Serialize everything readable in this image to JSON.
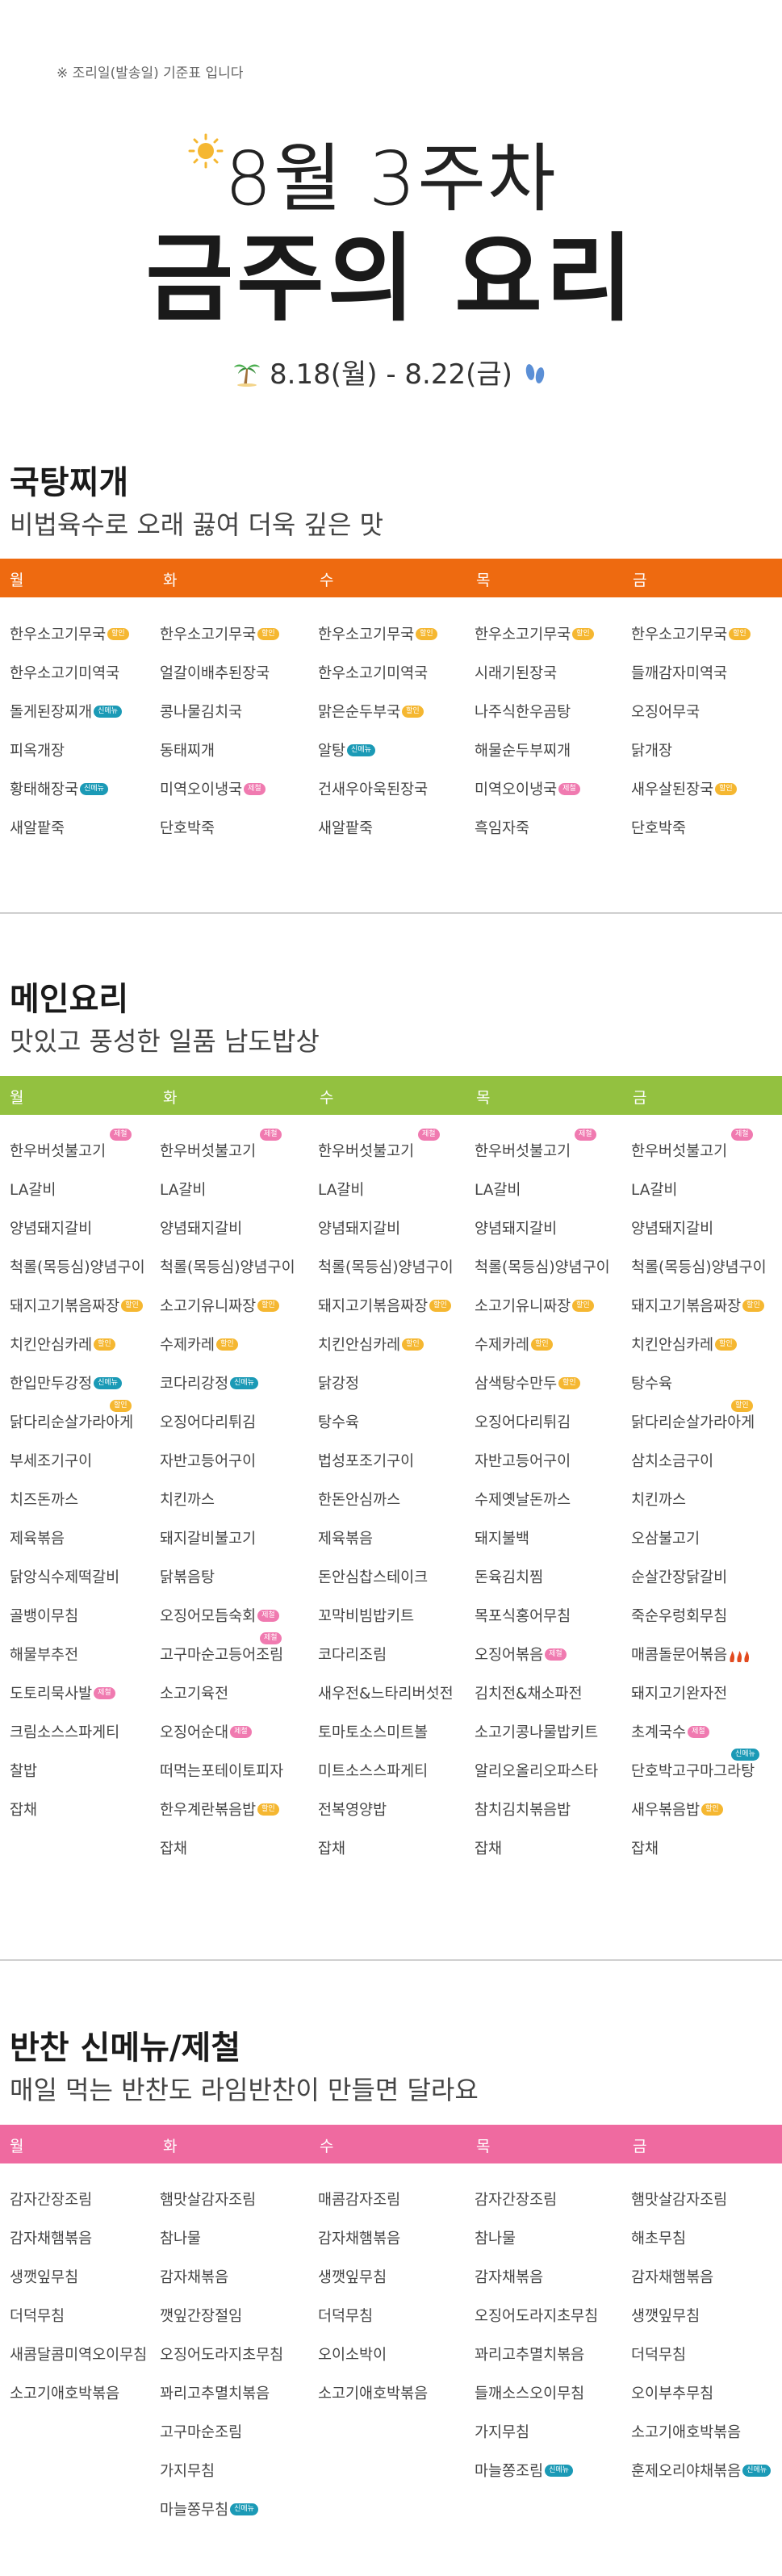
{
  "notice": "※ 조리일(발송일) 기준표 입니다",
  "hero": {
    "line1": "8월 3주차",
    "line2": "금주의 요리",
    "date_range": "8.18(월) - 8.22(금)"
  },
  "colors": {
    "orange": "#ee6a10",
    "green": "#93c140",
    "pink": "#ef6aa0",
    "badge_yellow": "#f5b731",
    "badge_pink": "#f07ab0",
    "badge_teal": "#1b9ab6"
  },
  "icons": [
    "sun-icon",
    "palm-icon",
    "feet-icon",
    "flame-icon"
  ],
  "days": [
    "월",
    "화",
    "수",
    "목",
    "금"
  ],
  "sections": [
    {
      "title": "국탕찌개",
      "subtitle": "비법육수로 오래 끓여 더욱 깊은 맛",
      "columns": [
        [
          {
            "name": "한우소고기무국",
            "badge": "할인",
            "badge_color": "yellow"
          },
          {
            "name": "한우소고기미역국"
          },
          {
            "name": "돌게된장찌개",
            "badge": "신메뉴",
            "badge_color": "teal"
          },
          {
            "name": "피옥개장"
          },
          {
            "name": "황태해장국",
            "badge": "신메뉴",
            "badge_color": "teal"
          },
          {
            "name": "새알팥죽"
          }
        ],
        [
          {
            "name": "한우소고기무국",
            "badge": "할인",
            "badge_color": "yellow"
          },
          {
            "name": "얼갈이배추된장국"
          },
          {
            "name": "콩나물김치국"
          },
          {
            "name": "동태찌개"
          },
          {
            "name": "미역오이냉국",
            "badge": "제철",
            "badge_color": "pink"
          },
          {
            "name": "단호박죽"
          }
        ],
        [
          {
            "name": "한우소고기무국",
            "badge": "할인",
            "badge_color": "yellow"
          },
          {
            "name": "한우소고기미역국"
          },
          {
            "name": "맑은순두부국",
            "badge": "할인",
            "badge_color": "yellow"
          },
          {
            "name": "알탕",
            "badge": "신메뉴",
            "badge_color": "teal"
          },
          {
            "name": "건새우아욱된장국"
          },
          {
            "name": "새알팥죽"
          }
        ],
        [
          {
            "name": "한우소고기무국",
            "badge": "할인",
            "badge_color": "yellow"
          },
          {
            "name": "시래기된장국"
          },
          {
            "name": "나주식한우곰탕"
          },
          {
            "name": "해물순두부찌개"
          },
          {
            "name": "미역오이냉국",
            "badge": "제철",
            "badge_color": "pink"
          },
          {
            "name": "흑임자죽"
          }
        ],
        [
          {
            "name": "한우소고기무국",
            "badge": "할인",
            "badge_color": "yellow"
          },
          {
            "name": "들깨감자미역국"
          },
          {
            "name": "오징어무국"
          },
          {
            "name": "닭개장"
          },
          {
            "name": "새우살된장국",
            "badge": "할인",
            "badge_color": "yellow"
          },
          {
            "name": "단호박죽"
          }
        ]
      ]
    },
    {
      "title": "메인요리",
      "subtitle": "맛있고 풍성한 일품 남도밥상",
      "columns": [
        [
          {
            "name": "한우버섯불고기",
            "badge": "제철",
            "badge_color": "pink",
            "badge_top": true
          },
          {
            "name": "LA갈비"
          },
          {
            "name": "양념돼지갈비"
          },
          {
            "name": "척롤(목등심)양념구이"
          },
          {
            "name": "돼지고기볶음짜장",
            "badge": "할인",
            "badge_color": "yellow"
          },
          {
            "name": "치킨안심카레",
            "badge": "할인",
            "badge_color": "yellow"
          },
          {
            "name": "한입만두강정",
            "badge": "신메뉴",
            "badge_color": "teal"
          },
          {
            "name": "닭다리순살가라아게",
            "badge": "할인",
            "badge_color": "yellow",
            "badge_top": true
          },
          {
            "name": "부세조기구이"
          },
          {
            "name": "치즈돈까스"
          },
          {
            "name": "제육볶음"
          },
          {
            "name": "닭앙식수제떡갈비"
          },
          {
            "name": "골뱅이무침"
          },
          {
            "name": "해물부추전"
          },
          {
            "name": "도토리묵사발",
            "badge": "제철",
            "badge_color": "pink"
          },
          {
            "name": "크림소스스파게티"
          },
          {
            "name": "찰밥"
          },
          {
            "name": "잡채"
          }
        ],
        [
          {
            "name": "한우버섯불고기",
            "badge": "제철",
            "badge_color": "pink",
            "badge_top": true
          },
          {
            "name": "LA갈비"
          },
          {
            "name": "양념돼지갈비"
          },
          {
            "name": "척롤(목등심)양념구이"
          },
          {
            "name": "소고기유니짜장",
            "badge": "할인",
            "badge_color": "yellow"
          },
          {
            "name": "수제카레",
            "badge": "할인",
            "badge_color": "yellow"
          },
          {
            "name": "코다리강정",
            "badge": "신메뉴",
            "badge_color": "teal"
          },
          {
            "name": "오징어다리튀김"
          },
          {
            "name": "자반고등어구이"
          },
          {
            "name": "치킨까스"
          },
          {
            "name": "돼지갈비불고기"
          },
          {
            "name": "닭볶음탕"
          },
          {
            "name": "오징어모듬숙회",
            "badge": "제철",
            "badge_color": "pink"
          },
          {
            "name": "고구마순고등어조림",
            "badge": "제철",
            "badge_color": "pink",
            "badge_top": true
          },
          {
            "name": "소고기육전"
          },
          {
            "name": "오징어순대",
            "badge": "제철",
            "badge_color": "pink"
          },
          {
            "name": "떠먹는포테이토피자"
          },
          {
            "name": "한우계란볶음밥",
            "badge": "할인",
            "badge_color": "yellow"
          },
          {
            "name": "잡채"
          }
        ],
        [
          {
            "name": "한우버섯불고기",
            "badge": "제철",
            "badge_color": "pink",
            "badge_top": true
          },
          {
            "name": "LA갈비"
          },
          {
            "name": "양념돼지갈비"
          },
          {
            "name": "척롤(목등심)양념구이"
          },
          {
            "name": "돼지고기볶음짜장",
            "badge": "할인",
            "badge_color": "yellow"
          },
          {
            "name": "치킨안심카레",
            "badge": "할인",
            "badge_color": "yellow"
          },
          {
            "name": "닭강정"
          },
          {
            "name": "탕수육"
          },
          {
            "name": "법성포조기구이"
          },
          {
            "name": "한돈안심까스"
          },
          {
            "name": "제육볶음"
          },
          {
            "name": "돈안심찹스테이크"
          },
          {
            "name": "꼬막비빔밥키트"
          },
          {
            "name": "코다리조림"
          },
          {
            "name": "새우전&느타리버섯전"
          },
          {
            "name": "토마토소스미트볼"
          },
          {
            "name": "미트소스스파게티"
          },
          {
            "name": "전복영양밥"
          },
          {
            "name": "잡채"
          }
        ],
        [
          {
            "name": "한우버섯불고기",
            "badge": "제철",
            "badge_color": "pink",
            "badge_top": true
          },
          {
            "name": "LA갈비"
          },
          {
            "name": "양념돼지갈비"
          },
          {
            "name": "척롤(목등심)양념구이"
          },
          {
            "name": "소고기유니짜장",
            "badge": "할인",
            "badge_color": "yellow"
          },
          {
            "name": "수제카레",
            "badge": "할인",
            "badge_color": "yellow"
          },
          {
            "name": "삼색탕수만두",
            "badge": "할인",
            "badge_color": "yellow"
          },
          {
            "name": "오징어다리튀김"
          },
          {
            "name": "자반고등어구이"
          },
          {
            "name": "수제옛날돈까스"
          },
          {
            "name": "돼지불백"
          },
          {
            "name": "돈육김치찜"
          },
          {
            "name": "목포식홍어무침"
          },
          {
            "name": "오징어볶음",
            "badge": "제철",
            "badge_color": "pink"
          },
          {
            "name": "김치전&채소파전"
          },
          {
            "name": "소고기콩나물밥키트"
          },
          {
            "name": "알리오올리오파스타"
          },
          {
            "name": "참치김치볶음밥"
          },
          {
            "name": "잡채"
          }
        ],
        [
          {
            "name": "한우버섯불고기",
            "badge": "제철",
            "badge_color": "pink",
            "badge_top": true
          },
          {
            "name": "LA갈비"
          },
          {
            "name": "양념돼지갈비"
          },
          {
            "name": "척롤(목등심)양념구이"
          },
          {
            "name": "돼지고기볶음짜장",
            "badge": "할인",
            "badge_color": "yellow"
          },
          {
            "name": "치킨안심카레",
            "badge": "할인",
            "badge_color": "yellow"
          },
          {
            "name": "탕수육"
          },
          {
            "name": "닭다리순살가라아게",
            "badge": "할인",
            "badge_color": "yellow",
            "badge_top": true
          },
          {
            "name": "삼치소금구이"
          },
          {
            "name": "치킨까스"
          },
          {
            "name": "오삼불고기"
          },
          {
            "name": "순살간장닭갈비"
          },
          {
            "name": "죽순우렁회무침"
          },
          {
            "name": "매콤돌문어볶음",
            "flame": true
          },
          {
            "name": "돼지고기완자전"
          },
          {
            "name": "초계국수",
            "badge": "제철",
            "badge_color": "pink"
          },
          {
            "name": "단호박고구마그라탕",
            "badge": "신메뉴",
            "badge_color": "teal",
            "badge_top": true
          },
          {
            "name": "새우볶음밥",
            "badge": "할인",
            "badge_color": "yellow"
          },
          {
            "name": "잡채"
          }
        ]
      ]
    },
    {
      "title": "반찬 신메뉴/제철",
      "subtitle": "매일 먹는 반찬도 라임반찬이 만들면 달라요",
      "columns": [
        [
          {
            "name": "감자간장조림"
          },
          {
            "name": "감자채햄볶음"
          },
          {
            "name": "생깻잎무침"
          },
          {
            "name": "더덕무침"
          },
          {
            "name": "새콤달콤미역오이무침"
          },
          {
            "name": "소고기애호박볶음"
          }
        ],
        [
          {
            "name": "햄맛살감자조림"
          },
          {
            "name": "참나물"
          },
          {
            "name": "감자채볶음"
          },
          {
            "name": "깻잎간장절임"
          },
          {
            "name": "오징어도라지초무침"
          },
          {
            "name": "꽈리고추멸치볶음"
          },
          {
            "name": "고구마순조림"
          },
          {
            "name": "가지무침"
          },
          {
            "name": "마늘쫑무침",
            "badge": "신메뉴",
            "badge_color": "teal"
          }
        ],
        [
          {
            "name": "매콤감자조림"
          },
          {
            "name": "감자채햄볶음"
          },
          {
            "name": "생깻잎무침"
          },
          {
            "name": "더덕무침"
          },
          {
            "name": "오이소박이"
          },
          {
            "name": "소고기애호박볶음"
          }
        ],
        [
          {
            "name": "감자간장조림"
          },
          {
            "name": "참나물"
          },
          {
            "name": "감자채볶음"
          },
          {
            "name": "오징어도라지초무침"
          },
          {
            "name": "꽈리고추멸치볶음"
          },
          {
            "name": "들깨소스오이무침"
          },
          {
            "name": "가지무침"
          },
          {
            "name": "마늘쫑조림",
            "badge": "신메뉴",
            "badge_color": "teal"
          }
        ],
        [
          {
            "name": "햄맛살감자조림"
          },
          {
            "name": "해초무침"
          },
          {
            "name": "감자채햄볶음"
          },
          {
            "name": "생깻잎무침"
          },
          {
            "name": "더덕무침"
          },
          {
            "name": "오이부추무침"
          },
          {
            "name": "소고기애호박볶음"
          },
          {
            "name": "훈제오리야채볶음",
            "badge": "신메뉴",
            "badge_color": "teal"
          }
        ]
      ]
    }
  ]
}
